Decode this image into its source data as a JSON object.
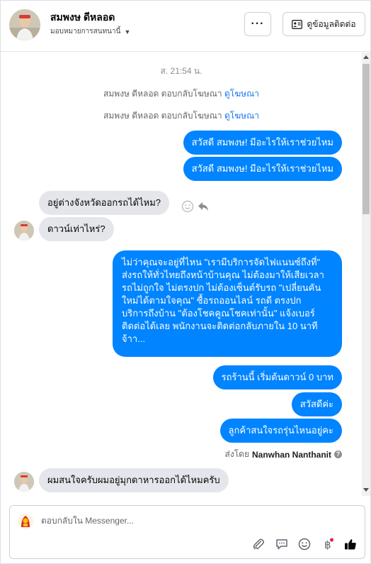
{
  "header": {
    "contact_name": "สมพงษ ดีหลอด",
    "assign_label": "มอบหมายการสนทนานี้",
    "more_label": "···",
    "info_label": "ดูข้อมูลติดต่อ"
  },
  "chat": {
    "timestamp": "ส. 21:54 น.",
    "system_lines": [
      {
        "text": "สมพงษ ดีหลอด ตอบกลับโฆษณา",
        "link": "ดูโฆษณา"
      },
      {
        "text": "สมพงษ ดีหลอด ตอบกลับโฆษณา",
        "link": "ดูโฆษณา"
      }
    ],
    "greeting_1": "สวัสดี สมพงษ! มีอะไรให้เราช่วยไหม",
    "greeting_2": "สวัสดี สมพงษ! มีอะไรให้เราช่วยไหม",
    "incoming_1": "อยู่ต่างจังหวัดออกรถได้ไหม?",
    "incoming_2": "ดาวน์เท่าไหร่?",
    "long_reply": [
      "ไม่ว่าคุณจะอยู่ที่ไหน \"เรามีบริการจัดไฟแนนซ์ถึงที่\"",
      "ส่งรถให้ทั่วไทยถึงหน้าบ้านคุณ ไม่ต้องมาให้เสียเวลา",
      "รถไม่ถูกใจ ไม่ตรงปก ไม่ต้องเซ็นต์รับรถ \"เปลี่ยนคัน",
      "ใหม่ได้ตามใจคุณ\" ซื้อรถออนไลน์ รถดี ตรงปก",
      "บริการถึงบ้าน \"ต้องโชคคูณโชคเท่านั้น\" แจ้งเบอร์",
      "ติดต่อได้เลย พนักงานจะติดต่อกลับภายใน 10 นาที",
      "จ้าา..."
    ],
    "reply_down": "รถร้านนี้ เริ่มต้นดาวน์ 0 บาท",
    "reply_hello": "สวัสดีค่ะ",
    "reply_model": "ลูกค้าสนใจรถรุ่นไหนอยู่คะ",
    "sent_by_prefix": "ส่งโดย",
    "sent_by_name": "Nanwhan Nanthanit",
    "incoming_3": "ผมสนใจครับผมอยู่มุกดาหารออกได้ไหมครับ"
  },
  "composer": {
    "placeholder": "ตอบกลับใน Messenger..."
  },
  "colors": {
    "outgoing_bubble": "#0084ff",
    "incoming_bubble": "#e4e6eb",
    "link": "#1877f2"
  }
}
